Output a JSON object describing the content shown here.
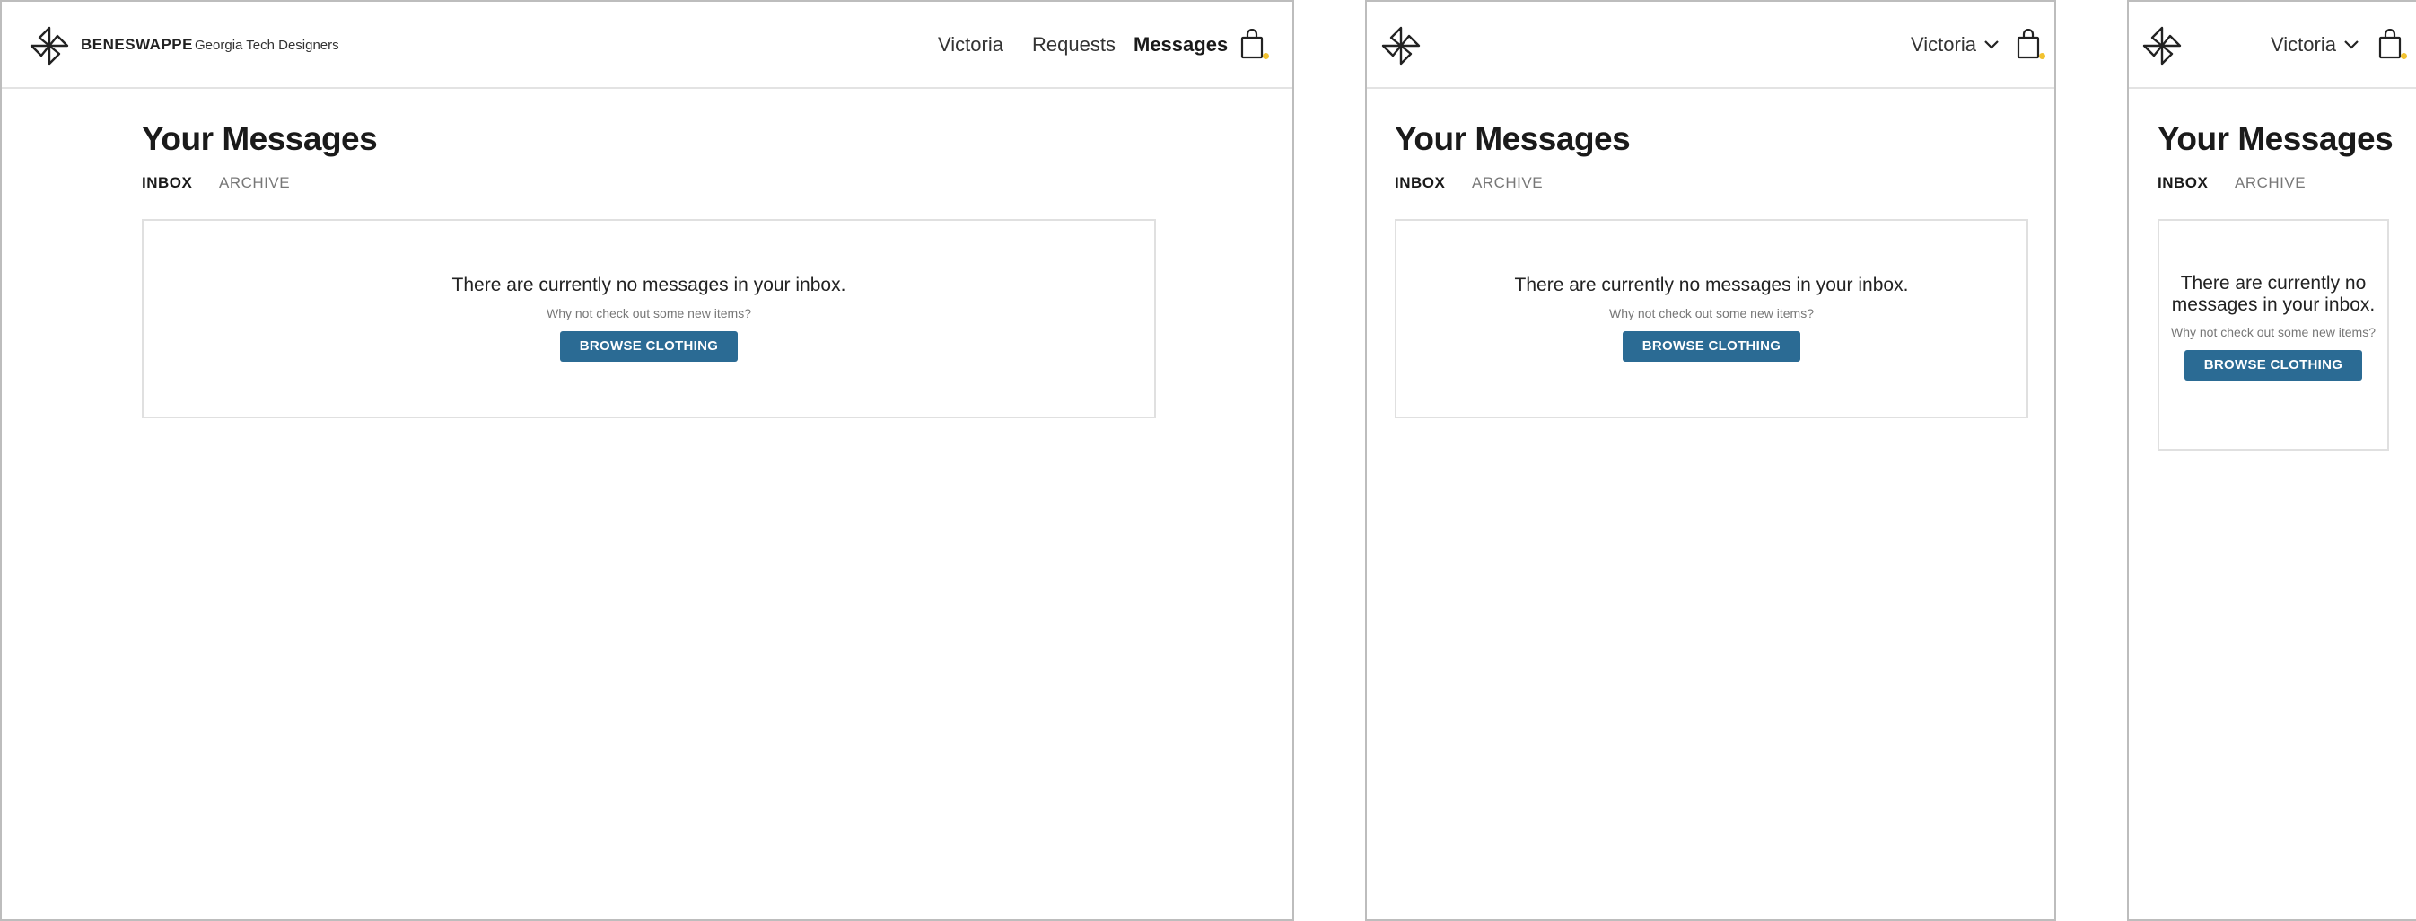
{
  "brand": {
    "name": "BENESWAPPE",
    "org": "Georgia Tech Designers",
    "logo_icon": "pinwheel-logo-icon"
  },
  "nav": {
    "user": "Victoria",
    "requests": "Requests",
    "messages": "Messages",
    "cart_icon": "shopping-bag-icon"
  },
  "page": {
    "title": "Your Messages",
    "tabs": [
      {
        "label": "INBOX",
        "active": true
      },
      {
        "label": "ARCHIVE",
        "active": false
      }
    ]
  },
  "empty_state": {
    "message": "There are currently no messages in your inbox.",
    "message_line1": "There are currently no",
    "message_line2": "messages in your inbox.",
    "hint": "Why not check out some new items?",
    "button": "BROWSE CLOTHING"
  },
  "colors": {
    "button_bg": "#2b6b94",
    "cart_badge": "#f2c230",
    "frame_border": "#bdbdbd"
  }
}
